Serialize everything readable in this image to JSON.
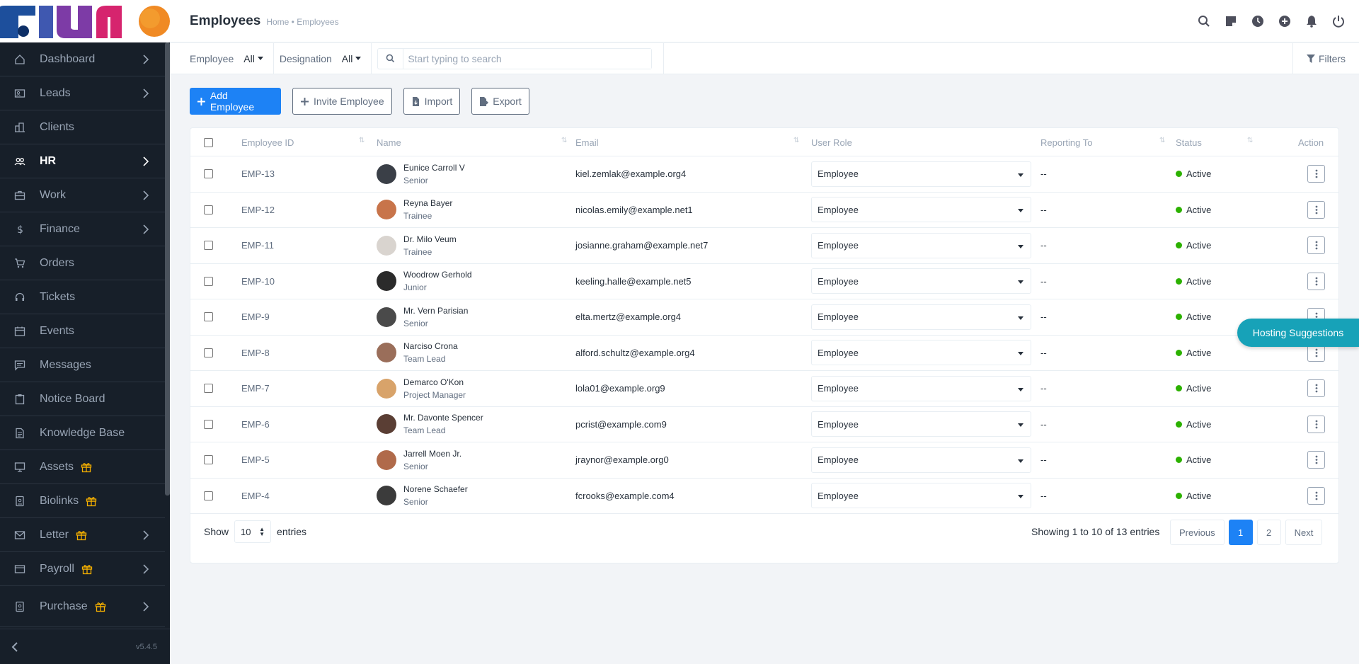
{
  "header": {
    "title": "Employees",
    "breadcrumb": "Home • Employees"
  },
  "sidebar": {
    "items": [
      {
        "label": "Dashboard",
        "icon": "home-icon",
        "chevron": true,
        "gift": false,
        "active": false
      },
      {
        "label": "Leads",
        "icon": "contact-card-icon",
        "chevron": true,
        "gift": false,
        "active": false
      },
      {
        "label": "Clients",
        "icon": "building-icon",
        "chevron": false,
        "gift": false,
        "active": false
      },
      {
        "label": "HR",
        "icon": "people-icon",
        "chevron": true,
        "gift": false,
        "active": true
      },
      {
        "label": "Work",
        "icon": "briefcase-icon",
        "chevron": true,
        "gift": false,
        "active": false
      },
      {
        "label": "Finance",
        "icon": "dollar-icon",
        "chevron": true,
        "gift": false,
        "active": false
      },
      {
        "label": "Orders",
        "icon": "cart-icon",
        "chevron": false,
        "gift": false,
        "active": false
      },
      {
        "label": "Tickets",
        "icon": "headset-icon",
        "chevron": false,
        "gift": false,
        "active": false
      },
      {
        "label": "Events",
        "icon": "calendar-icon",
        "chevron": false,
        "gift": false,
        "active": false
      },
      {
        "label": "Messages",
        "icon": "chat-icon",
        "chevron": false,
        "gift": false,
        "active": false
      },
      {
        "label": "Notice Board",
        "icon": "clipboard-icon",
        "chevron": false,
        "gift": false,
        "active": false
      },
      {
        "label": "Knowledge Base",
        "icon": "document-icon",
        "chevron": false,
        "gift": false,
        "active": false
      },
      {
        "label": "Assets",
        "icon": "monitor-icon",
        "chevron": false,
        "gift": true,
        "active": false
      },
      {
        "label": "Biolinks",
        "icon": "badge-icon",
        "chevron": false,
        "gift": true,
        "active": false
      },
      {
        "label": "Letter",
        "icon": "envelope-icon",
        "chevron": true,
        "gift": true,
        "active": false
      },
      {
        "label": "Payroll",
        "icon": "wallet-icon",
        "chevron": true,
        "gift": true,
        "active": false
      },
      {
        "label": "Purchase",
        "icon": "badge-icon",
        "chevron": true,
        "gift": true,
        "active": false
      }
    ],
    "version": "v5.4.5"
  },
  "filters": {
    "employee_label": "Employee",
    "employee_value": "All",
    "designation_label": "Designation",
    "designation_value": "All",
    "search_placeholder": "Start typing to search",
    "filters_label": "Filters"
  },
  "toolbar": {
    "add_label": "Add Employee",
    "invite_label": "Invite Employee",
    "import_label": "Import",
    "export_label": "Export"
  },
  "table": {
    "columns": [
      "Employee ID",
      "Name",
      "Email",
      "User Role",
      "Reporting To",
      "Status",
      "Action"
    ],
    "rows": [
      {
        "id": "EMP-13",
        "name": "Eunice Carroll V",
        "designation": "Senior",
        "email": "kiel.zemlak@example.org4",
        "role": "Employee",
        "reporting": "--",
        "status": "Active"
      },
      {
        "id": "EMP-12",
        "name": "Reyna Bayer",
        "designation": "Trainee",
        "email": "nicolas.emily@example.net1",
        "role": "Employee",
        "reporting": "--",
        "status": "Active"
      },
      {
        "id": "EMP-11",
        "name": "Dr. Milo Veum",
        "designation": "Trainee",
        "email": "josianne.graham@example.net7",
        "role": "Employee",
        "reporting": "--",
        "status": "Active"
      },
      {
        "id": "EMP-10",
        "name": "Woodrow Gerhold",
        "designation": "Junior",
        "email": "keeling.halle@example.net5",
        "role": "Employee",
        "reporting": "--",
        "status": "Active"
      },
      {
        "id": "EMP-9",
        "name": "Mr. Vern Parisian",
        "designation": "Senior",
        "email": "elta.mertz@example.org4",
        "role": "Employee",
        "reporting": "--",
        "status": "Active"
      },
      {
        "id": "EMP-8",
        "name": "Narciso Crona",
        "designation": "Team Lead",
        "email": "alford.schultz@example.org4",
        "role": "Employee",
        "reporting": "--",
        "status": "Active"
      },
      {
        "id": "EMP-7",
        "name": "Demarco O'Kon",
        "designation": "Project Manager",
        "email": "lola01@example.org9",
        "role": "Employee",
        "reporting": "--",
        "status": "Active"
      },
      {
        "id": "EMP-6",
        "name": "Mr. Davonte Spencer",
        "designation": "Team Lead",
        "email": "pcrist@example.com9",
        "role": "Employee",
        "reporting": "--",
        "status": "Active"
      },
      {
        "id": "EMP-5",
        "name": "Jarrell Moen Jr.",
        "designation": "Senior",
        "email": "jraynor@example.org0",
        "role": "Employee",
        "reporting": "--",
        "status": "Active"
      },
      {
        "id": "EMP-4",
        "name": "Norene Schaefer",
        "designation": "Senior",
        "email": "fcrooks@example.com4",
        "role": "Employee",
        "reporting": "--",
        "status": "Active"
      }
    ]
  },
  "footer": {
    "show_label": "Show",
    "page_size": "10",
    "entries_label": "entries",
    "info": "Showing 1 to 10 of 13 entries",
    "prev_label": "Previous",
    "pages": [
      "1",
      "2"
    ],
    "next_label": "Next"
  },
  "floating": {
    "hosting_label": "Hosting Suggestions"
  },
  "colors": {
    "primary": "#1d82f5",
    "sidebar_bg": "#171f29",
    "status_active": "#2cb100",
    "hosting": "#17a2b8",
    "gift": "#f5b000"
  }
}
